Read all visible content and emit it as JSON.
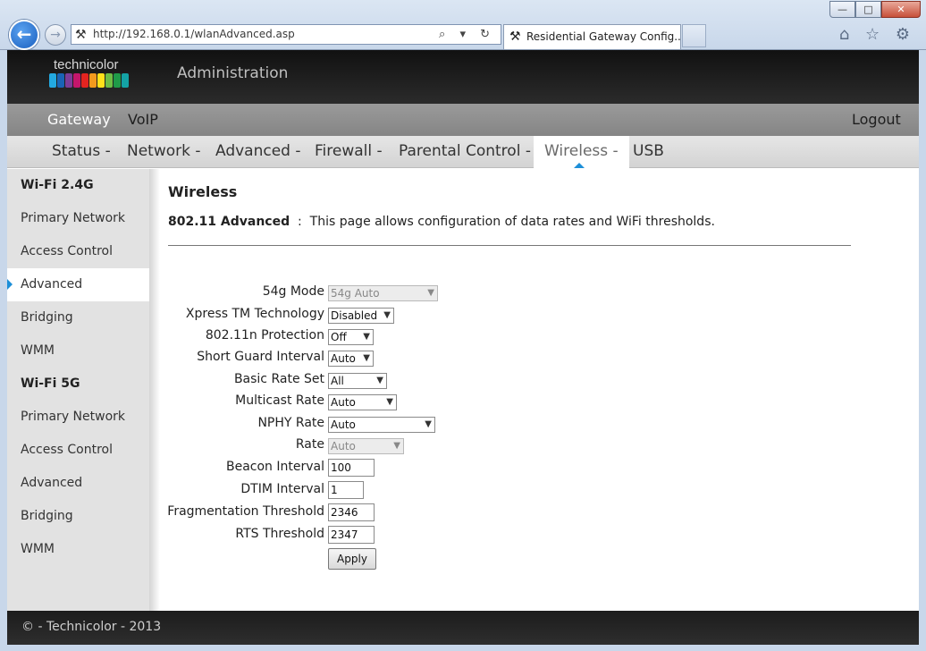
{
  "browser": {
    "url": "http://192.168.0.1/wlanAdvanced.asp",
    "tab_title": "Residential Gateway Config...",
    "win_min": "—",
    "win_max": "□",
    "win_close": "✕",
    "back_glyph": "←",
    "fwd_glyph": "→",
    "address_controls": "⌕ ▾ ↻",
    "fav_icons": "⌂ ☆ ⚙"
  },
  "header": {
    "brand": "technicolor",
    "title": "Administration",
    "logo_colors": [
      "#23a9e1",
      "#1a64b5",
      "#7c3d98",
      "#c4166c",
      "#e32420",
      "#f39a1d",
      "#ffe11a",
      "#6ebe45",
      "#1f9b48",
      "#14a3a5"
    ]
  },
  "menu1": {
    "gateway": "Gateway",
    "voip": "VoIP",
    "logout": "Logout"
  },
  "menu2": {
    "status": "Status -",
    "network": "Network -",
    "advanced": "Advanced -",
    "firewall": "Firewall -",
    "parental": "Parental Control -",
    "wireless": "Wireless -",
    "usb": "USB"
  },
  "sidebar": {
    "items": [
      {
        "label": "Wi-Fi 2.4G"
      },
      {
        "label": "Primary Network"
      },
      {
        "label": "Access Control"
      },
      {
        "label": "Advanced"
      },
      {
        "label": "Bridging"
      },
      {
        "label": "WMM"
      },
      {
        "label": "Wi-Fi 5G"
      },
      {
        "label": "Primary Network"
      },
      {
        "label": "Access Control"
      },
      {
        "label": "Advanced"
      },
      {
        "label": "Bridging"
      },
      {
        "label": "WMM"
      }
    ]
  },
  "main": {
    "title": "Wireless",
    "desc_bold": "802.11 Advanced",
    "desc_sep": ":",
    "desc_text": "This page allows configuration of data rates and WiFi thresholds.",
    "fields": {
      "mode54g": {
        "label": "54g Mode",
        "value": "54g Auto"
      },
      "xpress": {
        "label": "Xpress TM Technology",
        "value": "Disabled"
      },
      "protection": {
        "label": "802.11n Protection",
        "value": "Off"
      },
      "guard": {
        "label": "Short Guard Interval",
        "value": "Auto"
      },
      "basic_rate": {
        "label": "Basic Rate Set",
        "value": "All"
      },
      "multicast": {
        "label": "Multicast Rate",
        "value": "Auto"
      },
      "nphy": {
        "label": "NPHY Rate",
        "value": "Auto"
      },
      "rate": {
        "label": "Rate",
        "value": "Auto"
      },
      "beacon": {
        "label": "Beacon Interval",
        "value": "100"
      },
      "dtim": {
        "label": "DTIM Interval",
        "value": "1"
      },
      "frag": {
        "label": "Fragmentation Threshold",
        "value": "2346"
      },
      "rts": {
        "label": "RTS Threshold",
        "value": "2347"
      }
    },
    "apply_label": "Apply",
    "dropdown_glyph": "▼"
  },
  "footer": {
    "text": "© - Technicolor - 2013"
  }
}
